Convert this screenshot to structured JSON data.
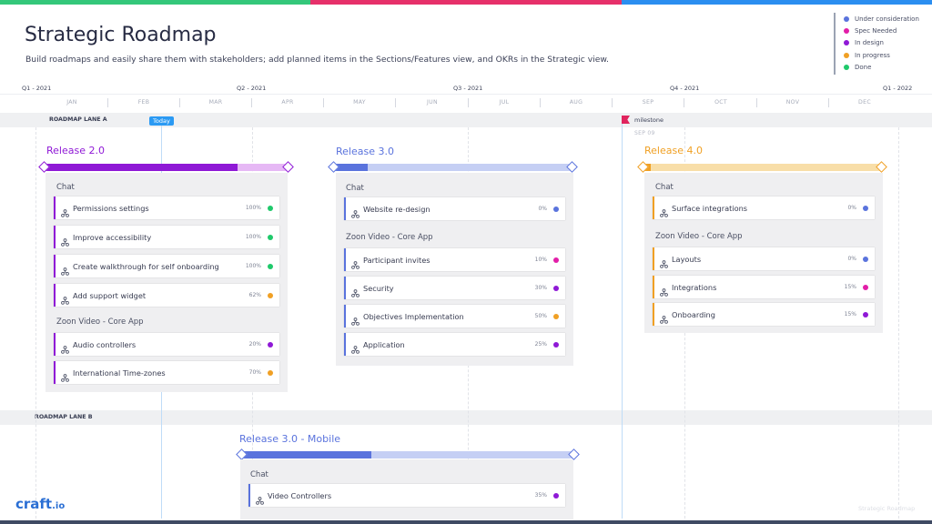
{
  "header": {
    "title": "Strategic Roadmap",
    "subtitle": "Build roadmaps and easily share them with stakeholders; add planned items in the Sections/Features view, and OKRs in the Strategic view.",
    "bar_colors": [
      "#34c77a",
      "#e6306a",
      "#2b8ef0"
    ]
  },
  "legend": [
    {
      "label": "Under consideration",
      "color": "#5a73dd"
    },
    {
      "label": "Spec Needed",
      "color": "#e21ea8"
    },
    {
      "label": "In design",
      "color": "#8f19d6"
    },
    {
      "label": "In progress",
      "color": "#f0a024"
    },
    {
      "label": "Done",
      "color": "#1fc96b"
    }
  ],
  "timeline": {
    "quarters": [
      "Q1 - 2021",
      "Q2 - 2021",
      "Q3 - 2021",
      "Q4 - 2021",
      "Q1 - 2022"
    ],
    "months": [
      "JAN",
      "FEB",
      "MAR",
      "APR",
      "MAY",
      "JUN",
      "JUL",
      "AUG",
      "SEP",
      "OCT",
      "NOV",
      "DEC"
    ],
    "today_label": "Today",
    "milestone": {
      "label": "milestone",
      "date": "SEP 09"
    }
  },
  "lanes": [
    {
      "name": "ROADMAP LANE A",
      "releases": [
        {
          "title": "Release 2.0",
          "color": "#8f19d6",
          "track": "#e6b8f5",
          "progress": 0.79,
          "groups": [
            {
              "label": "Chat",
              "items": [
                {
                  "name": "Permissions settings",
                  "pct": "100%",
                  "status": "#1fc96b",
                  "accent": "#8f19d6"
                },
                {
                  "name": "Improve accessibility",
                  "pct": "100%",
                  "status": "#1fc96b",
                  "accent": "#8f19d6"
                },
                {
                  "name": "Create walkthrough for self onboarding",
                  "pct": "100%",
                  "status": "#1fc96b",
                  "accent": "#8f19d6"
                },
                {
                  "name": "Add support widget",
                  "pct": "62%",
                  "status": "#f0a024",
                  "accent": "#8f19d6"
                }
              ]
            },
            {
              "label": "Zoon Video - Core App",
              "items": [
                {
                  "name": "Audio controllers",
                  "pct": "20%",
                  "status": "#8f19d6",
                  "accent": "#8f19d6"
                },
                {
                  "name": "International Time-zones",
                  "pct": "70%",
                  "status": "#f0a024",
                  "accent": "#8f19d6"
                }
              ]
            }
          ]
        },
        {
          "title": "Release 3.0",
          "color": "#5a73dd",
          "track": "#c5cff4",
          "progress": 0.14,
          "groups": [
            {
              "label": "Chat",
              "items": [
                {
                  "name": "Website re-design",
                  "pct": "0%",
                  "status": "#5a73dd",
                  "accent": "#5a73dd"
                }
              ]
            },
            {
              "label": "Zoon Video - Core App",
              "items": [
                {
                  "name": "Participant invites",
                  "pct": "10%",
                  "status": "#e21ea8",
                  "accent": "#5a73dd"
                },
                {
                  "name": "Security",
                  "pct": "30%",
                  "status": "#8f19d6",
                  "accent": "#5a73dd"
                },
                {
                  "name": "Objectives Implementation",
                  "pct": "50%",
                  "status": "#f0a024",
                  "accent": "#5a73dd"
                },
                {
                  "name": "Application",
                  "pct": "25%",
                  "status": "#8f19d6",
                  "accent": "#5a73dd"
                }
              ]
            }
          ]
        },
        {
          "title": "Release 4.0",
          "color": "#f0a024",
          "track": "#f8dea8",
          "progress": 0.03,
          "groups": [
            {
              "label": "Chat",
              "items": [
                {
                  "name": "Surface integrations",
                  "pct": "0%",
                  "status": "#5a73dd",
                  "accent": "#f0a024"
                }
              ]
            },
            {
              "label": "Zoon Video - Core App",
              "items": [
                {
                  "name": "Layouts",
                  "pct": "0%",
                  "status": "#5a73dd",
                  "accent": "#f0a024"
                },
                {
                  "name": "Integrations",
                  "pct": "15%",
                  "status": "#e21ea8",
                  "accent": "#f0a024"
                },
                {
                  "name": "Onboarding",
                  "pct": "15%",
                  "status": "#8f19d6",
                  "accent": "#f0a024"
                }
              ]
            }
          ]
        }
      ]
    },
    {
      "name": "ROADMAP LANE B",
      "releases": [
        {
          "title": "Release 3.0 - Mobile",
          "color": "#5a73dd",
          "track": "#c5cff4",
          "progress": 0.39,
          "groups": [
            {
              "label": "Chat",
              "items": [
                {
                  "name": "Video Controllers",
                  "pct": "35%",
                  "status": "#8f19d6",
                  "accent": "#5a73dd"
                }
              ]
            }
          ]
        }
      ]
    }
  ],
  "brand": {
    "logo": "craft",
    "logo_suffix": ".io",
    "footer": "Strategic Roadmap"
  }
}
